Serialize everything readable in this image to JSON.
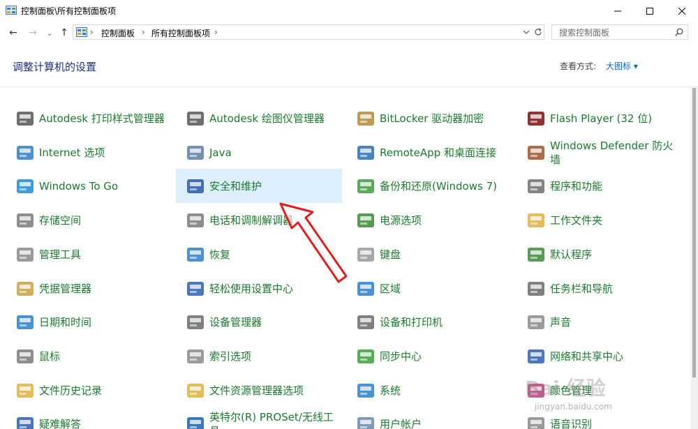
{
  "window": {
    "title": "控制面板\\所有控制面板项"
  },
  "nav": {
    "back": "←",
    "forward": "→",
    "recent": "⌄",
    "up": "↑"
  },
  "address": {
    "crumbs": [
      "控制面板",
      "所有控制面板项"
    ],
    "sep": "›"
  },
  "search": {
    "placeholder": "搜索控制面板"
  },
  "header": {
    "title": "调整计算机的设置",
    "view_by_label": "查看方式:",
    "view_by_value": "大图标 ▾"
  },
  "items": [
    {
      "label": "Autodesk 打印样式管理器",
      "icon": "printer-style-icon",
      "color": "#555555"
    },
    {
      "label": "Autodesk 绘图仪管理器",
      "icon": "plotter-icon",
      "color": "#555555"
    },
    {
      "label": "BitLocker 驱动器加密",
      "icon": "bitlocker-icon",
      "color": "#b08a3a"
    },
    {
      "label": "Flash Player (32 位)",
      "icon": "flash-icon",
      "color": "#7a1010"
    },
    {
      "label": "Internet 选项",
      "icon": "internet-options-icon",
      "color": "#2a7fc9"
    },
    {
      "label": "Java",
      "icon": "java-icon",
      "color": "#5a7ea8"
    },
    {
      "label": "RemoteApp 和桌面连接",
      "icon": "remoteapp-icon",
      "color": "#2a6fb5"
    },
    {
      "label": "Windows Defender 防火墙",
      "icon": "firewall-icon",
      "color": "#a0522d"
    },
    {
      "label": "Windows To Go",
      "icon": "windows-to-go-icon",
      "color": "#1e88d8"
    },
    {
      "label": "安全和维护",
      "icon": "security-flag-icon",
      "color": "#2857a8"
    },
    {
      "label": "备份和还原(Windows 7)",
      "icon": "backup-icon",
      "color": "#3e9a3e"
    },
    {
      "label": "程序和功能",
      "icon": "programs-icon",
      "color": "#6e6e6e"
    },
    {
      "label": "存储空间",
      "icon": "storage-icon",
      "color": "#7a7a7a"
    },
    {
      "label": "电话和调制解调器",
      "icon": "phone-modem-icon",
      "color": "#7a7a7a"
    },
    {
      "label": "电源选项",
      "icon": "power-icon",
      "color": "#3a8a3a"
    },
    {
      "label": "工作文件夹",
      "icon": "work-folders-icon",
      "color": "#e0b040"
    },
    {
      "label": "管理工具",
      "icon": "admin-tools-icon",
      "color": "#8a8a8a"
    },
    {
      "label": "恢复",
      "icon": "recovery-icon",
      "color": "#2a7fc9"
    },
    {
      "label": "键盘",
      "icon": "keyboard-icon",
      "color": "#9a9a9a"
    },
    {
      "label": "默认程序",
      "icon": "default-programs-icon",
      "color": "#3a8a3a"
    },
    {
      "label": "凭据管理器",
      "icon": "credential-icon",
      "color": "#c8a040"
    },
    {
      "label": "轻松使用设置中心",
      "icon": "ease-of-access-icon",
      "color": "#2a5fb0"
    },
    {
      "label": "区域",
      "icon": "region-icon",
      "color": "#2a7fc9"
    },
    {
      "label": "任务栏和导航",
      "icon": "taskbar-icon",
      "color": "#6a6a6a"
    },
    {
      "label": "日期和时间",
      "icon": "datetime-icon",
      "color": "#2a7fc9"
    },
    {
      "label": "设备管理器",
      "icon": "device-manager-icon",
      "color": "#6a6a6a"
    },
    {
      "label": "设备和打印机",
      "icon": "devices-printers-icon",
      "color": "#6a6a6a"
    },
    {
      "label": "声音",
      "icon": "sound-icon",
      "color": "#8a8a8a"
    },
    {
      "label": "鼠标",
      "icon": "mouse-icon",
      "color": "#7a7a7a"
    },
    {
      "label": "索引选项",
      "icon": "indexing-icon",
      "color": "#8a8a8a"
    },
    {
      "label": "同步中心",
      "icon": "sync-icon",
      "color": "#3aa03a"
    },
    {
      "label": "网络和共享中心",
      "icon": "network-icon",
      "color": "#2a5fb0"
    },
    {
      "label": "文件历史记录",
      "icon": "file-history-icon",
      "color": "#e0b040"
    },
    {
      "label": "文件资源管理器选项",
      "icon": "explorer-options-icon",
      "color": "#e0b040"
    },
    {
      "label": "系统",
      "icon": "system-icon",
      "color": "#2a7fc9"
    },
    {
      "label": "颜色管理",
      "icon": "color-management-icon",
      "color": "#c04080"
    },
    {
      "label": "疑难解答",
      "icon": "troubleshooting-icon",
      "color": "#2a5fb0"
    },
    {
      "label": "英特尔(R) PROSet/无线工具",
      "icon": "intel-wireless-icon",
      "color": "#1a5fb0"
    },
    {
      "label": "用户帐户",
      "icon": "user-accounts-icon",
      "color": "#6a8aaa"
    },
    {
      "label": "语音识别",
      "icon": "speech-icon",
      "color": "#8a8a8a"
    }
  ],
  "watermark": {
    "brand": "Bai 经验",
    "url": "jingyan.baidu.com"
  },
  "colors": {
    "link_green": "#1c7a2e",
    "heading_blue": "#1e3287",
    "selection": "#ddeefc",
    "arrow_red": "#e21d1d"
  }
}
